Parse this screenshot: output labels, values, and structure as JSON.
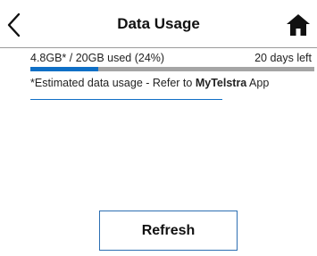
{
  "header": {
    "title": "Data Usage",
    "back_icon": "chevron-left-icon",
    "home_icon": "home-icon"
  },
  "usage": {
    "used_text": "4.8GB* / 20GB used (24%)",
    "days_left_text": "20 days left",
    "progress_fraction": 0.24
  },
  "note": {
    "prefix": "*Estimated data usage - Refer to ",
    "app_name": "MyTelstra",
    "suffix": " App"
  },
  "refresh_label": "Refresh",
  "colors": {
    "accent": "#0f6fc6",
    "track": "#a5a5a5",
    "button_border": "#2d6fb2"
  }
}
